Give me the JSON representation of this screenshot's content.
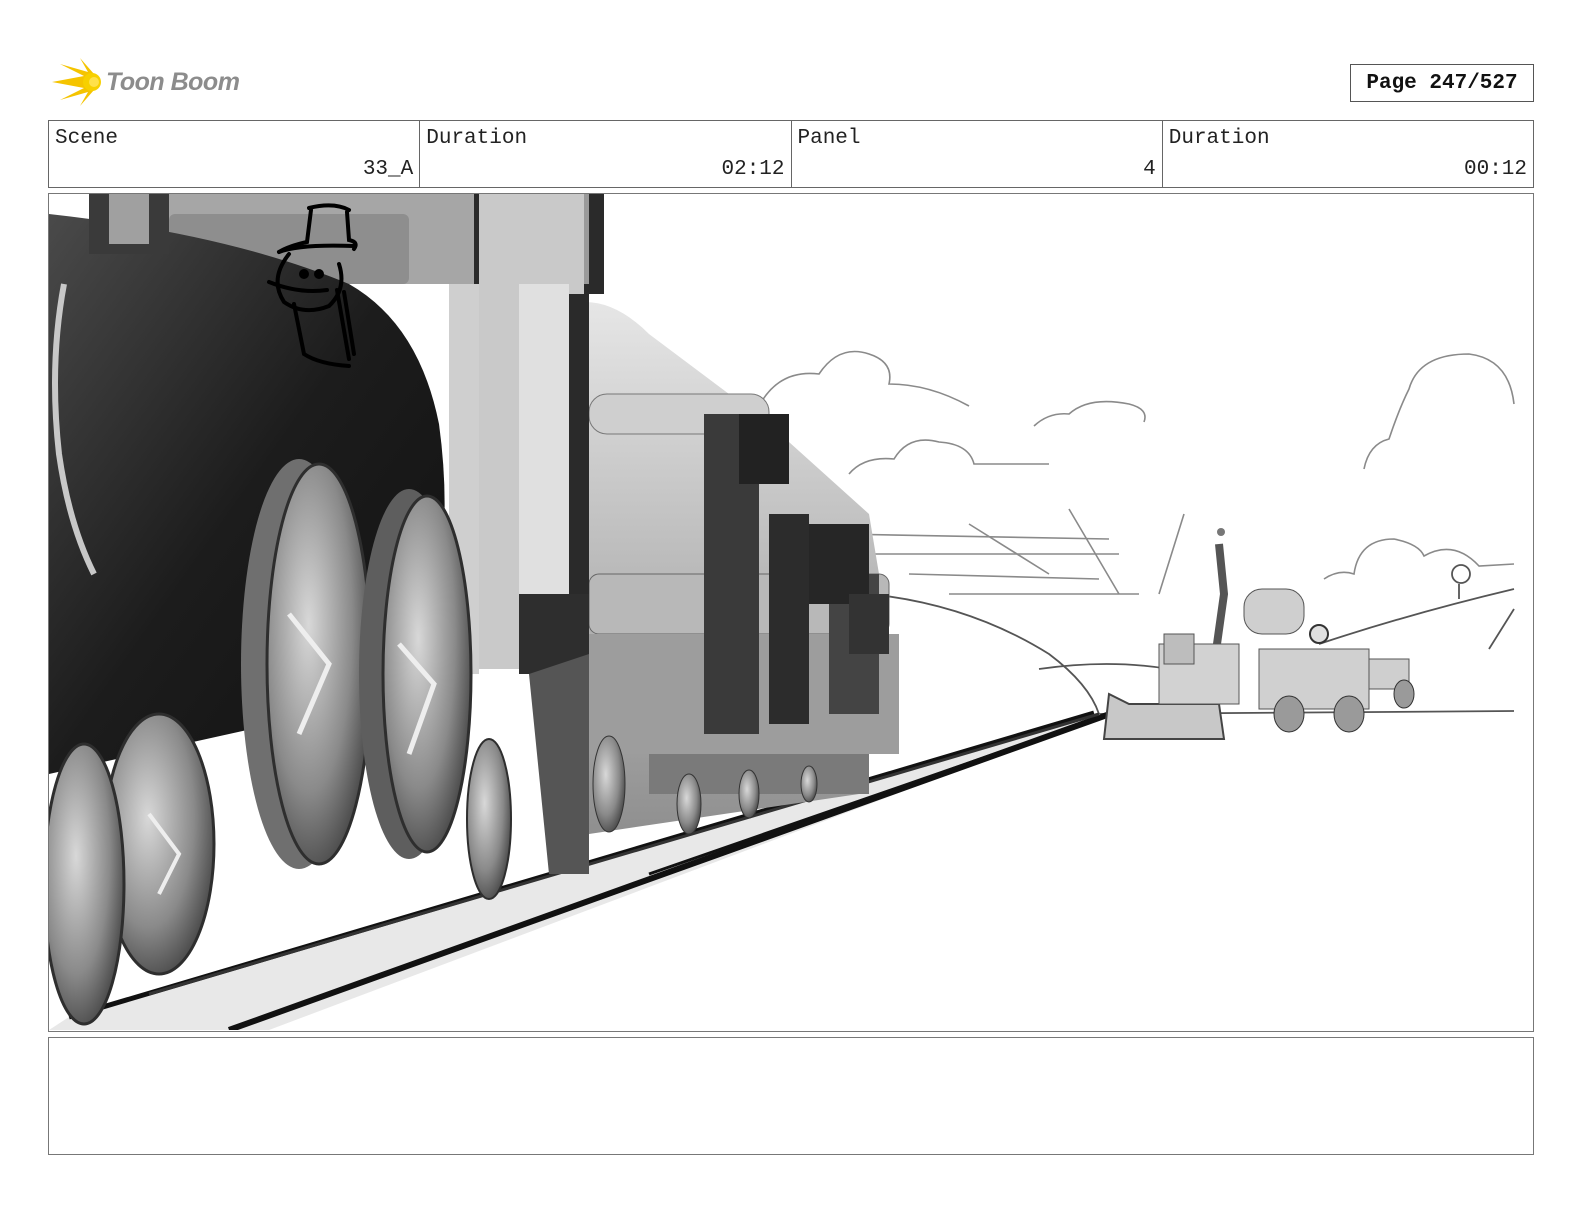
{
  "header": {
    "logo_text": "Toon Boom",
    "logo_icon": "toon-boom-burst-icon",
    "page_label": "Page 247/527"
  },
  "info": {
    "scene_label": "Scene",
    "scene_value": "33_A",
    "duration_label": "Duration",
    "duration_value": "02:12",
    "panel_label": "Panel",
    "panel_value": "4",
    "panel_duration_label": "Duration",
    "panel_duration_value": "00:12"
  },
  "notes": {
    "text": ""
  },
  "colors": {
    "logo_yellow": "#f5c400",
    "logo_text": "#8c8c8c",
    "border": "#666666"
  }
}
